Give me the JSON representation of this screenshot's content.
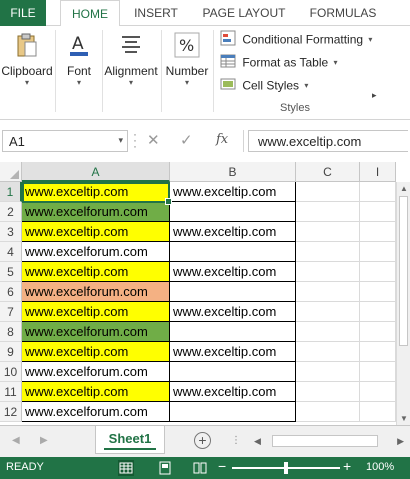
{
  "ribbon": {
    "tabs": [
      "FILE",
      "HOME",
      "INSERT",
      "PAGE LAYOUT",
      "FORMULAS"
    ],
    "active_tab": "HOME",
    "groups": {
      "clipboard": "Clipboard",
      "font": "Font",
      "alignment": "Alignment",
      "number": "Number"
    },
    "styles": {
      "conditional_formatting": "Conditional Formatting",
      "format_as_table": "Format as Table",
      "cell_styles": "Cell Styles",
      "group_label": "Styles"
    }
  },
  "formula_bar": {
    "name_box": "A1",
    "fx_label": "fx",
    "value": "www.exceltip.com"
  },
  "grid": {
    "columns": [
      "A",
      "B",
      "C",
      "I"
    ],
    "active_column": "A",
    "active_row": "1",
    "rows": [
      {
        "num": "1",
        "a": "www.exceltip.com",
        "a_fill": "#ffff00",
        "b": "www.exceltip.com"
      },
      {
        "num": "2",
        "a": "www.excelforum.com",
        "a_fill": "#70ad47",
        "b": ""
      },
      {
        "num": "3",
        "a": "www.exceltip.com",
        "a_fill": "#ffff00",
        "b": "www.exceltip.com"
      },
      {
        "num": "4",
        "a": "www.excelforum.com",
        "a_fill": "#ffffff",
        "b": ""
      },
      {
        "num": "5",
        "a": "www.exceltip.com",
        "a_fill": "#ffff00",
        "b": "www.exceltip.com"
      },
      {
        "num": "6",
        "a": "www.excelforum.com",
        "a_fill": "#f4b183",
        "b": ""
      },
      {
        "num": "7",
        "a": "www.exceltip.com",
        "a_fill": "#ffff00",
        "b": "www.exceltip.com"
      },
      {
        "num": "8",
        "a": "www.excelforum.com",
        "a_fill": "#70ad47",
        "b": ""
      },
      {
        "num": "9",
        "a": "www.exceltip.com",
        "a_fill": "#ffff00",
        "b": "www.exceltip.com"
      },
      {
        "num": "10",
        "a": "www.excelforum.com",
        "a_fill": "#ffffff",
        "b": ""
      },
      {
        "num": "11",
        "a": "www.exceltip.com",
        "a_fill": "#ffff00",
        "b": "www.exceltip.com"
      },
      {
        "num": "12",
        "a": "www.excelforum.com",
        "a_fill": "#ffffff",
        "b": ""
      }
    ]
  },
  "sheets": {
    "active": "Sheet1"
  },
  "status": {
    "ready": "READY",
    "zoom": "100%"
  },
  "colors": {
    "accent": "#217346",
    "yellow": "#ffff00",
    "green": "#70ad47",
    "orange": "#f4b183"
  }
}
